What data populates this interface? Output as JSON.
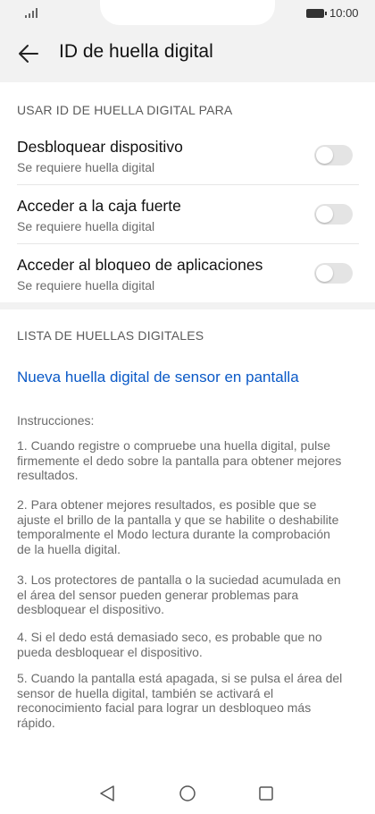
{
  "status_bar": {
    "time": "10:00",
    "signal_icon": "signal-icon",
    "battery_icon": "battery-icon"
  },
  "header": {
    "title": "ID de huella digital",
    "back_icon": "arrow-left-icon"
  },
  "section_use": {
    "header": "USAR ID DE HUELLA DIGITAL PARA",
    "items": [
      {
        "title": "Desbloquear dispositivo",
        "subtitle": "Se requiere huella digital",
        "enabled": false
      },
      {
        "title": "Acceder a la caja fuerte",
        "subtitle": "Se requiere huella digital",
        "enabled": false
      },
      {
        "title": "Acceder al bloqueo de aplicaciones",
        "subtitle": "Se requiere huella digital",
        "enabled": false
      }
    ]
  },
  "section_list": {
    "header": "LISTA DE HUELLAS DIGITALES",
    "new_fingerprint": "Nueva huella digital de sensor en pantalla",
    "instructions_title": "Instrucciones:",
    "instructions": [
      "1. Cuando registre o compruebe una huella digital, pulse firmemente el dedo sobre la pantalla para obtener mejores resultados.",
      "2. Para obtener mejores resultados, es posible que se ajuste el brillo de la pantalla y que se habilite o deshabilite temporalmente el Modo lectura durante la comprobación de la huella digital.",
      "3. Los protectores de pantalla o la suciedad acumulada en el área del sensor pueden generar problemas para desbloquear el dispositivo.",
      "4. Si el dedo está demasiado seco, es probable que no pueda desbloquear el dispositivo.",
      "5. Cuando la pantalla está apagada, si se pulsa el área del sensor de huella digital, también se activará el reconocimiento facial para lograr un desbloqueo más rápido."
    ]
  },
  "navbar": {
    "back_icon": "triangle-back-icon",
    "home_icon": "circle-home-icon",
    "recent_icon": "square-recent-icon"
  },
  "colors": {
    "accent": "#0a59c7",
    "background": "#f2f2f2",
    "card": "#ffffff",
    "toggle_off": "#e4e4e4"
  }
}
